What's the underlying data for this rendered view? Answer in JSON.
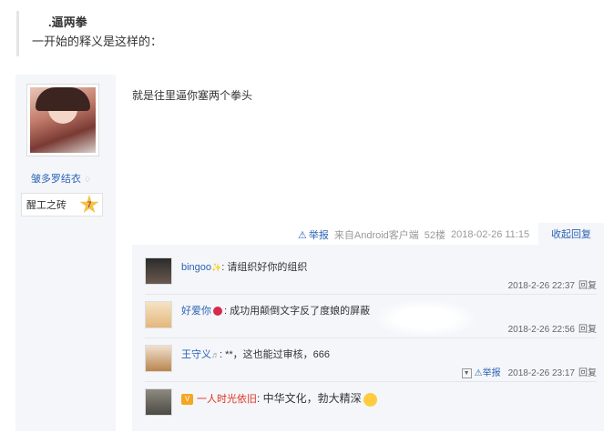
{
  "quote": {
    "title": ".逼两拳",
    "text": "一开始的释义是这样的："
  },
  "post": {
    "author": {
      "username": "皱多罗结衣",
      "username_icon": "gender-icon",
      "badge_name": "醒工之砖",
      "badge_level": "7"
    },
    "content": "就是往里逼你塞两个拳头",
    "meta": {
      "report_label": "举报",
      "source": "来自Android客户端",
      "floor": "52楼",
      "datetime": "2018-02-26 11:15",
      "collapse_label": "收起回复"
    }
  },
  "replies": [
    {
      "username": "bingoo",
      "text": ": 请组织好你的组织",
      "time": "2018-2-26 22:37",
      "reply_label": "回复"
    },
    {
      "username": "好爱你",
      "text": ": 成功用颠倒文字反了度娘的屏蔽",
      "time": "2018-2-26 22:56",
      "reply_label": "回复"
    },
    {
      "username": "王守义",
      "text": ": **，这也能过审核，666",
      "time": "2018-2-26 23:17",
      "reply_label": "回复",
      "report_label": "举报"
    },
    {
      "username": "一人时光依旧",
      "text": ": 中华文化，勃大精深",
      "vip_label": "V"
    }
  ],
  "colors": {
    "link": "#2d64b3",
    "panel": "#f4f6fa",
    "vip_name": "#e0301e"
  }
}
